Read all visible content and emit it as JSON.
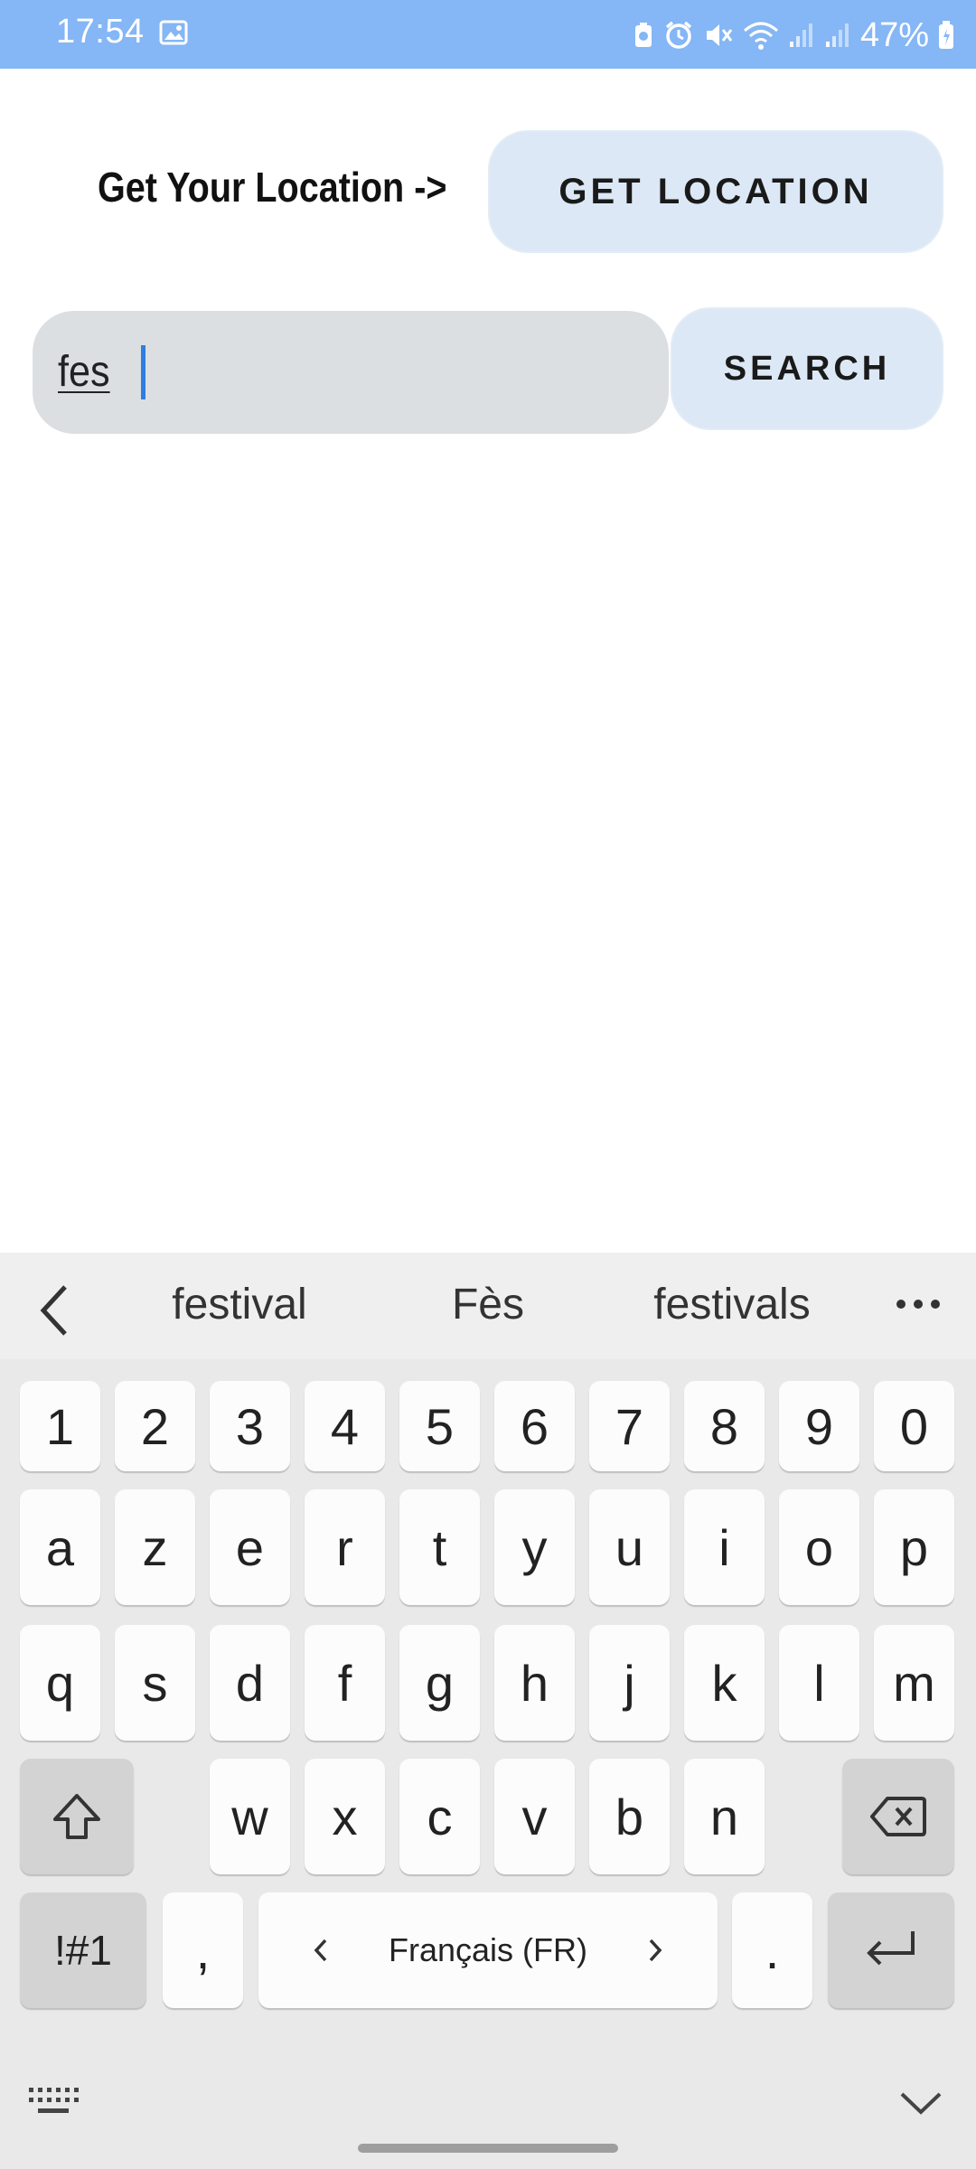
{
  "status_bar": {
    "time": "17:54",
    "battery": "47%",
    "icons": [
      "gallery-icon",
      "battery-saver-icon",
      "alarm-icon",
      "mute-icon",
      "wifi-icon",
      "signal-icon",
      "signal-icon-2",
      "battery-icon"
    ]
  },
  "app": {
    "location_label": "Get Your Location ->",
    "get_location_button": "GET LOCATION",
    "search_value": "fes",
    "search_button": "SEARCH"
  },
  "keyboard": {
    "suggestions": [
      "festival",
      "Fès",
      "festivals"
    ],
    "row_numbers": [
      "1",
      "2",
      "3",
      "4",
      "5",
      "6",
      "7",
      "8",
      "9",
      "0"
    ],
    "row_1": [
      "a",
      "z",
      "e",
      "r",
      "t",
      "y",
      "u",
      "i",
      "o",
      "p"
    ],
    "row_2": [
      "q",
      "s",
      "d",
      "f",
      "g",
      "h",
      "j",
      "k",
      "l",
      "m"
    ],
    "row_3": [
      "w",
      "x",
      "c",
      "v",
      "b",
      "n"
    ],
    "symbols_key": "!#1",
    "comma_key": ",",
    "space_label": "Français (FR)",
    "period_key": "."
  },
  "colors": {
    "status_bar": "#85b6f5",
    "button_bg": "#dce8f5",
    "field_bg": "#dcdfe2",
    "caret": "#2f7de1"
  }
}
